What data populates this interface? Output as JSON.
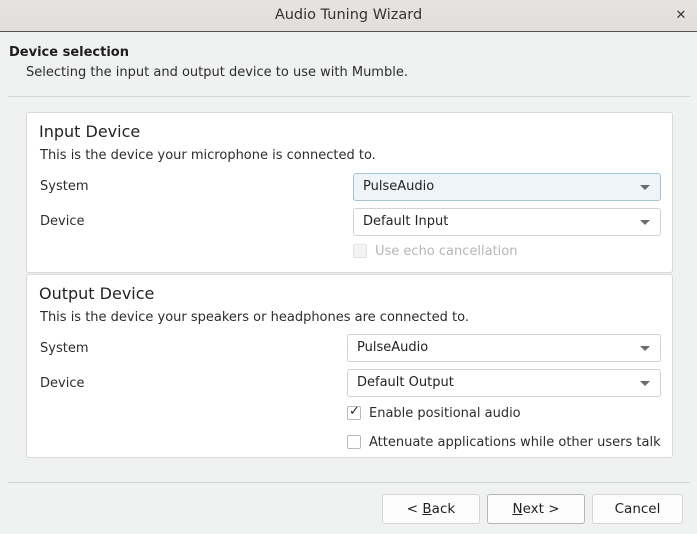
{
  "window": {
    "title": "Audio Tuning Wizard",
    "close_icon": "close-icon",
    "close_glyph": "✕"
  },
  "header": {
    "title": "Device selection",
    "subtitle": "Selecting the input and output device to use with Mumble."
  },
  "input_group": {
    "title": "Input Device",
    "description": "This is the device your microphone is connected to.",
    "system_label": "System",
    "system_value": "PulseAudio",
    "device_label": "Device",
    "device_value": "Default Input",
    "echo_label": "Use echo cancellation",
    "echo_checked": false,
    "echo_enabled": false
  },
  "output_group": {
    "title": "Output Device",
    "description": "This is the device your speakers or headphones are connected to.",
    "system_label": "System",
    "system_value": "PulseAudio",
    "device_label": "Device",
    "device_value": "Default Output",
    "positional_label": "Enable positional audio",
    "positional_checked": true,
    "positional_tick": "✓",
    "attenuate_label": "Attenuate applications while other users talk",
    "attenuate_checked": false
  },
  "footer": {
    "back_prefix": "< ",
    "back_mnemonic": "B",
    "back_suffix": "ack",
    "next_mnemonic": "N",
    "next_suffix": "ext >",
    "cancel_label": "Cancel"
  },
  "colors": {
    "titlebar_bg": "#e3e1df",
    "body_bg": "#f0f1f1",
    "group_bg": "#ffffff",
    "focus_border": "#a7c2d4",
    "focus_fill": "#eef4f8",
    "text": "#2d2d2d"
  }
}
